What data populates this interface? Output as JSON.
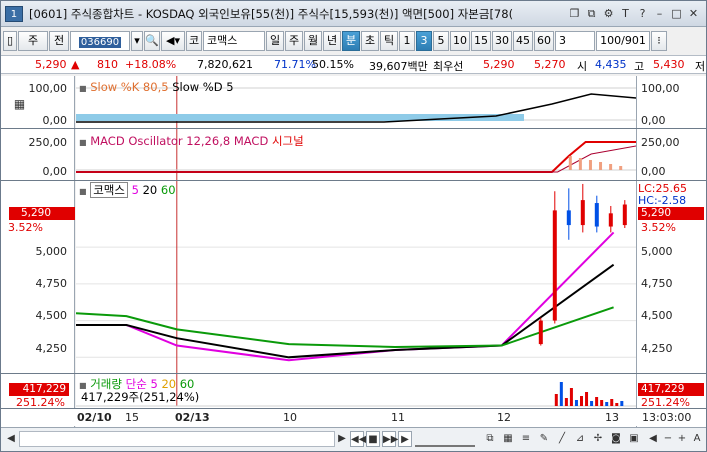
{
  "window": {
    "number": "1",
    "title": "[0601] 주식종합차트 - KOSDAQ 외국인보유[55(천)] 주식수[15,593(천)] 액면[500] 자본금[78(",
    "title_icons": [
      "restore-icon",
      "link-icon",
      "settings-icon",
      "T",
      "?",
      "minimize-icon",
      "maximize-icon",
      "close-icon"
    ]
  },
  "toolbar": {
    "market": "주",
    "period": "전",
    "code": "036690",
    "index_prefix": "코",
    "stock_name": "코맥스",
    "intervals": [
      "일",
      "주",
      "월",
      "년",
      "분",
      "초",
      "틱"
    ],
    "active_interval": "분",
    "minute_values": [
      "1",
      "3",
      "5",
      "10",
      "15",
      "30",
      "45",
      "60"
    ],
    "active_minute": "3",
    "count_value": "3",
    "display_count": "100/901"
  },
  "info": {
    "price": "5,290",
    "change": "810",
    "change_pct": "+18.08%",
    "volume": "7,820,621",
    "ratio1": "71.71%",
    "ratio2": "50.15%",
    "amount": "39,607백만",
    "priority_label": "최우선",
    "bid": "5,290",
    "ask": "5,270",
    "open_label": "시",
    "open": "4,435",
    "high_label": "고",
    "high": "5,430",
    "low_label": "저"
  },
  "panels": {
    "stoch": {
      "legend_k": "Slow %K 80,5",
      "legend_d": "Slow %D 5",
      "ticks": [
        "100,00",
        "0,00"
      ]
    },
    "macd": {
      "legend_osc": "MACD Oscillator 12,26,8",
      "legend_macd": "MACD",
      "legend_signal": "시그널",
      "ticks": [
        "250,00",
        "0,00"
      ]
    },
    "price": {
      "legend_name": "코맥스",
      "ma": [
        "5",
        "20",
        "60"
      ],
      "ticks": [
        "5,000",
        "4,750",
        "4,500",
        "4,250"
      ],
      "current": "5,290",
      "current_pct": "3.52%",
      "right_current": "5,290",
      "right_pct": "3.52%",
      "lc": "LC:25.65",
      "hc": "HC:-2.58"
    },
    "volume": {
      "legend_name": "거래량",
      "legend_type": "단순",
      "ma": [
        "5",
        "20",
        "60"
      ],
      "value_line": "417,229주(251,24%)",
      "left_value": "417,229",
      "left_pct": "251.24%",
      "right_value": "417,229",
      "right_pct": "251.24%"
    }
  },
  "xaxis": {
    "labels": [
      "02/10",
      "15",
      "02/13",
      "10",
      "11",
      "12",
      "13"
    ],
    "time": "13:03:00"
  },
  "colors": {
    "up": "#e00000",
    "down": "#0050e6",
    "ma5": "#e000e0",
    "ma20": "#000000",
    "ma60": "#0a9a0a",
    "highlight_box": "#e00000"
  },
  "chart_data": {
    "type": "line",
    "title": "코맥스",
    "xlabel": "",
    "ylabel": "",
    "x": [
      "02/10",
      "15",
      "02/13",
      "10",
      "11",
      "12",
      "13"
    ],
    "ylim": [
      4150,
      5450
    ],
    "series": [
      {
        "name": "5",
        "values": [
          4470,
          4470,
          4330,
          4230,
          4300,
          4330,
          5100
        ]
      },
      {
        "name": "20",
        "values": [
          4470,
          4470,
          4380,
          4250,
          4300,
          4330,
          4880
        ]
      },
      {
        "name": "60",
        "values": [
          4550,
          4530,
          4440,
          4340,
          4320,
          4330,
          4590
        ]
      }
    ]
  }
}
